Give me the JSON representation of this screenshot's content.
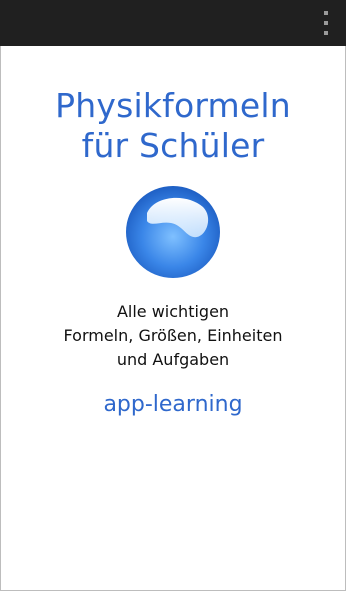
{
  "app": {
    "title_line1": "Physikformeln",
    "title_line2": "für Schüler",
    "desc_line1": "Alle wichtigen",
    "desc_line2": "Formeln, Größen, Einheiten",
    "desc_line3": "und Aufgaben",
    "brand": "app-learning"
  },
  "icons": {
    "overflow": "more-vert-icon",
    "logo": "blue-orb-logo"
  },
  "colors": {
    "accent": "#2f68cc",
    "topbar": "#202020"
  }
}
